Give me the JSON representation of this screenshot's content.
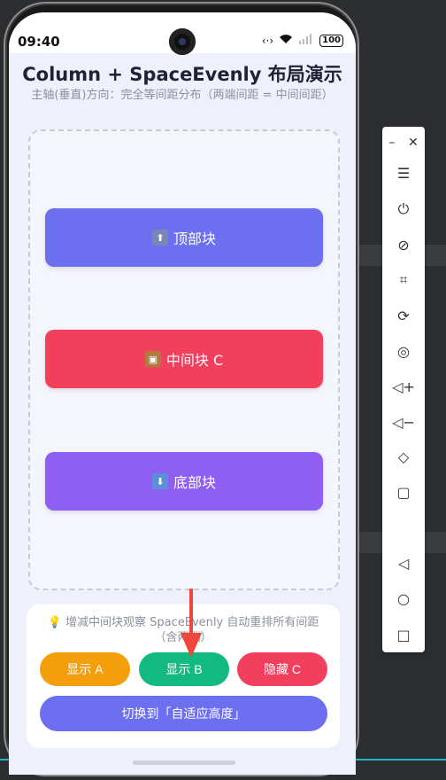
{
  "status_bar": {
    "time": "09:40",
    "battery": "100"
  },
  "header": {
    "title": "Column + SpaceEvenly 布局演示",
    "subtitle": "主轴(垂直)方向：完全等间距分布（两端间距 = 中间间距）"
  },
  "blocks": [
    {
      "label": "顶部块",
      "icon": "top-icon",
      "color": "#6b6ff0"
    },
    {
      "label": "中间块 C",
      "icon": "package-icon",
      "color": "#f23f5d"
    },
    {
      "label": "底部块",
      "icon": "down-arrow-icon",
      "color": "#8f5ef2"
    }
  ],
  "controls": {
    "hint": "增减中间块观察 SpaceEvenly 自动重排所有间距（含两端）",
    "buttons": [
      "显示 A",
      "显示 B",
      "隐藏 C"
    ],
    "switch_label": "切换到「自适应高度」"
  },
  "colors": {
    "accent": "#6b6ff0",
    "orange": "#f59e0b",
    "green": "#12b981",
    "red": "#f23f5d",
    "purple": "#8f5ef2"
  },
  "toolbar": {
    "items": [
      "minimize-icon",
      "close-icon",
      "menu-icon",
      "power-icon",
      "no-touch-icon",
      "crop-icon",
      "rotate-icon",
      "record-icon",
      "volume-up-icon",
      "volume-down-icon",
      "rotate-device-icon",
      "screen-icon",
      "back-icon",
      "home-icon",
      "recent-apps-icon"
    ]
  }
}
